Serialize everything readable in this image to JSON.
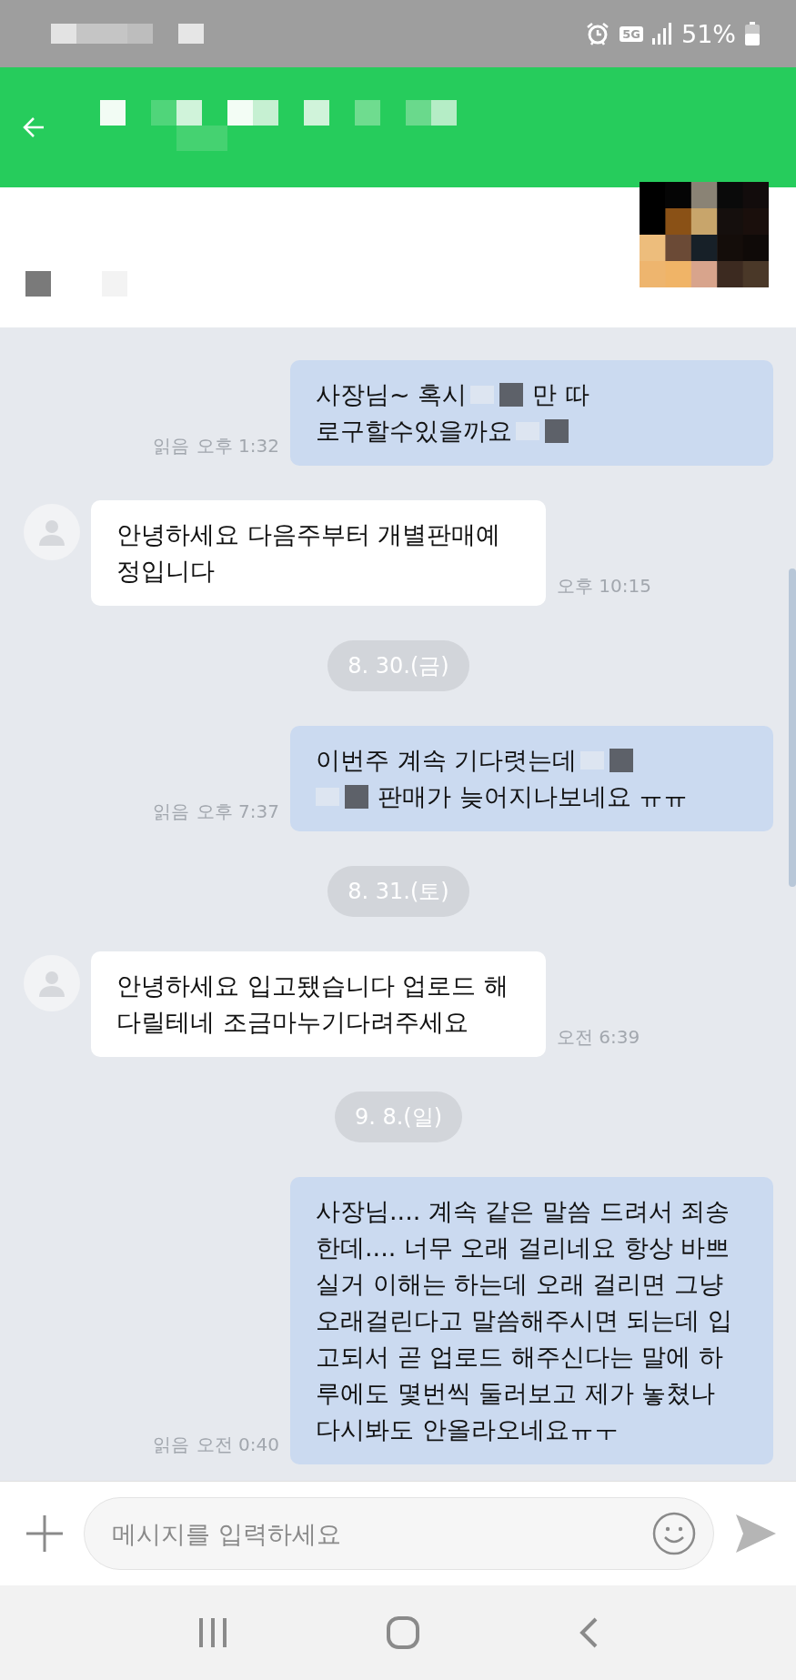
{
  "status_bar": {
    "network": "5G",
    "battery": "51%"
  },
  "chat": [
    {
      "kind": "sent",
      "lines": [
        [
          {
            "kind": "text",
            "text": "사장님~ 혹시"
          },
          {
            "kind": "redacted"
          },
          {
            "kind": "text",
            "text": "만 따"
          }
        ],
        [
          {
            "kind": "text",
            "text": "로구할수있을까요"
          },
          {
            "kind": "redacted"
          }
        ]
      ],
      "receipt": "읽음",
      "time": "오후 1:32"
    },
    {
      "kind": "received",
      "lines": [
        [
          {
            "kind": "text",
            "text": "안녕하세요 다음주부터 개별판매예"
          }
        ],
        [
          {
            "kind": "text",
            "text": "정입니다"
          }
        ]
      ],
      "time": "오후 10:15"
    },
    {
      "kind": "date",
      "text": "8. 30.(금)"
    },
    {
      "kind": "sent",
      "lines": [
        [
          {
            "kind": "text",
            "text": "이번주 계속 기다렷는데"
          },
          {
            "kind": "redacted"
          }
        ],
        [
          {
            "kind": "redacted"
          },
          {
            "kind": "text",
            "text": "판매가 늦어지나보네요 ㅠㅠ"
          }
        ]
      ],
      "receipt": "읽음",
      "time": "오후 7:37"
    },
    {
      "kind": "date",
      "text": "8. 31.(토)"
    },
    {
      "kind": "received",
      "lines": [
        [
          {
            "kind": "text",
            "text": "안녕하세요 입고됐습니다 업로드 해"
          }
        ],
        [
          {
            "kind": "text",
            "text": "다릴테네 조금마누기다려주세요"
          }
        ]
      ],
      "time": "오전 6:39"
    },
    {
      "kind": "date",
      "text": "9. 8.(일)"
    },
    {
      "kind": "sent",
      "lines": [
        [
          {
            "kind": "text",
            "text": "사장님.... 계속 같은 말씀 드려서 죄송"
          }
        ],
        [
          {
            "kind": "text",
            "text": "한데.... 너무 오래 걸리네요 항상 바쁘"
          }
        ],
        [
          {
            "kind": "text",
            "text": "실거 이해는 하는데 오래 걸리면 그냥"
          }
        ],
        [
          {
            "kind": "text",
            "text": "오래걸린다고 말씀해주시면 되는데 입"
          }
        ],
        [
          {
            "kind": "text",
            "text": "고되서 곧 업로드 해주신다는 말에 하"
          }
        ],
        [
          {
            "kind": "text",
            "text": "루에도 몇번씩 둘러보고 제가 놓쳤나"
          }
        ],
        [
          {
            "kind": "text",
            "text": "다시봐도 안올라오네요ㅠㅜ"
          }
        ]
      ],
      "receipt": "읽음",
      "time": "오전 0:40"
    }
  ],
  "composer": {
    "placeholder": "메시지를 입력하세요"
  }
}
